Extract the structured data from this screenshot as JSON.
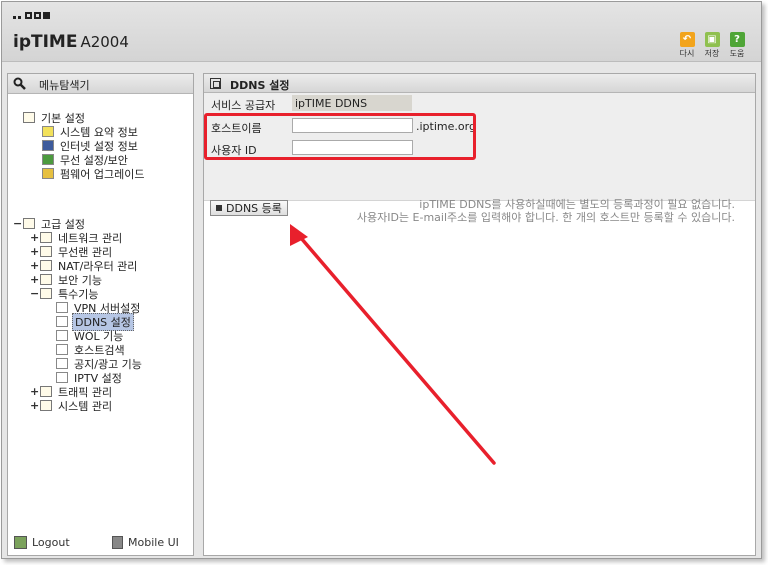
{
  "header": {
    "brand_main": "ipTIME",
    "brand_model": "A2004",
    "tools": [
      {
        "label": "다시",
        "color": "#f2a41c",
        "icon": "undo-icon"
      },
      {
        "label": "저장",
        "color": "#8fc04f",
        "icon": "save-icon"
      },
      {
        "label": "도움",
        "color": "#4fa537",
        "icon": "help-icon"
      }
    ]
  },
  "sidebar": {
    "title": "메뉴탐색기",
    "groups": [
      {
        "label": "기본 설정",
        "children": [
          "시스템 요약 정보",
          "인터넷 설정 정보",
          "무선 설정/보안",
          "펌웨어 업그레이드"
        ]
      },
      {
        "label": "고급 설정",
        "toggle": "−",
        "children": [
          {
            "label": "네트워크 관리",
            "toggle": "+"
          },
          {
            "label": "무선랜 관리",
            "toggle": "+"
          },
          {
            "label": "NAT/라우터 관리",
            "toggle": "+"
          },
          {
            "label": "보안 기능",
            "toggle": "+"
          },
          {
            "label": "특수기능",
            "toggle": "−",
            "children": [
              "VPN 서버설정",
              "DDNS 설정",
              "WOL 기능",
              "호스트검색",
              "공지/광고 기능",
              "IPTV 설정"
            ]
          },
          {
            "label": "트래픽 관리",
            "toggle": "+"
          },
          {
            "label": "시스템 관리",
            "toggle": "+"
          }
        ]
      }
    ],
    "logout": "Logout",
    "mobile": "Mobile UI"
  },
  "main": {
    "title": "DDNS 설정",
    "provider_label": "서비스 공급자",
    "provider_value": "ipTIME DDNS",
    "hostname_label": "호스트이름",
    "hostname_value": "",
    "hostname_suffix": ".iptime.org",
    "userid_label": "사용자 ID",
    "userid_value": "",
    "register_button": "DDNS 등록",
    "note_line1": "ipTIME DDNS를 사용하실때에는 별도의 등록과정이 필요 없습니다.",
    "note_line2": "사용자ID는 E-mail주소를 입력해야 합니다. 한 개의 호스트만 등록할 수 있습니다."
  },
  "annotation_color": "#e8202c"
}
